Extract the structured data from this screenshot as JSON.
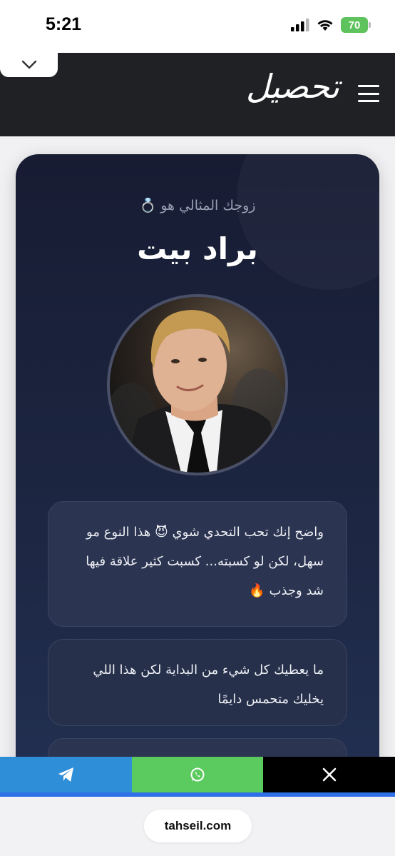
{
  "status": {
    "time": "5:21",
    "battery": "70"
  },
  "header": {
    "logo_text": "تحصيل"
  },
  "card": {
    "subtitle": "زوجك المثالي هو 💍",
    "title": "براد بيت",
    "descriptions": [
      "واضح إنك تحب التحدي شوي 😈 هذا النوع مو سهل، لكن لو كسبته... كسبت كثير علاقة فيها شد وجذب 🔥",
      "ما يعطيك كل شيء من البداية لكن هذا اللي يخليك متحمس دايمًا"
    ]
  },
  "share": {
    "telegram_icon": "telegram-icon",
    "whatsapp_icon": "whatsapp-icon",
    "x_icon": "x-icon"
  },
  "browser": {
    "url": "tahseil.com"
  },
  "colors": {
    "header_bg": "#1f2125",
    "card_top": "#171c33",
    "card_bottom": "#223052",
    "telegram": "#2f8ed8",
    "whatsapp": "#5ccb5f",
    "x": "#000000",
    "accent": "#2f6fe8"
  }
}
